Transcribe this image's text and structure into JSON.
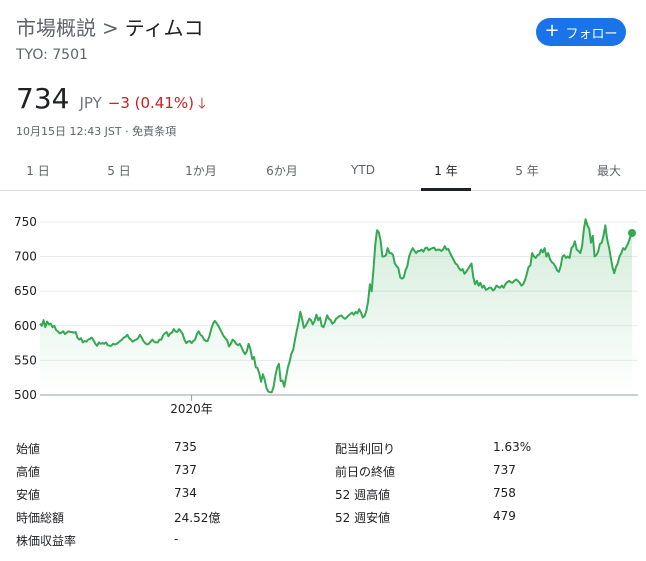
{
  "breadcrumb": {
    "overview": "市場概説",
    "separator": ">",
    "name": "ティムコ"
  },
  "ticker": "TYO: 7501",
  "follow_button": {
    "label": "フォロー",
    "icon": "plus-icon"
  },
  "quote": {
    "price": "734",
    "currency": "JPY",
    "change": "−3 (0.41%)",
    "direction_icon": "arrow-down-icon"
  },
  "timestamp": "10月15日 12:43 JST · 免責条項",
  "tabs": [
    {
      "label": "1 日",
      "active": false
    },
    {
      "label": "5 日",
      "active": false
    },
    {
      "label": "1か月",
      "active": false
    },
    {
      "label": "6か月",
      "active": false
    },
    {
      "label": "YTD",
      "active": false
    },
    {
      "label": "1 年",
      "active": true
    },
    {
      "label": "5 年",
      "active": false
    },
    {
      "label": "最大",
      "active": false
    }
  ],
  "colors": {
    "line": "#34a853",
    "down": "#c5221f",
    "accent": "#1a73e8"
  },
  "chart_data": {
    "type": "line",
    "ylim": [
      500,
      760
    ],
    "y_ticks": [
      500,
      550,
      600,
      650,
      700,
      750
    ],
    "x_tick_labels": [
      {
        "label": "2020年",
        "position": 0.256
      }
    ],
    "grid": true,
    "series": [
      {
        "values": [
          603,
          600,
          608,
          598,
          606,
          602,
          603,
          598,
          600,
          594,
          592,
          589,
          590,
          592,
          588,
          590,
          592,
          591,
          591,
          590,
          591,
          583,
          580,
          582,
          576,
          578,
          577,
          580,
          581,
          583,
          579,
          574,
          571,
          576,
          574,
          575,
          574,
          576,
          572,
          571,
          571,
          574,
          573,
          574,
          576,
          578,
          580,
          583,
          584,
          587,
          582,
          580,
          577,
          579,
          580,
          582,
          587,
          583,
          578,
          575,
          573,
          574,
          577,
          580,
          577,
          576,
          576,
          580,
          580,
          586,
          589,
          591,
          585,
          589,
          590,
          595,
          592,
          591,
          595,
          592,
          588,
          580,
          575,
          577,
          578,
          575,
          578,
          580,
          588,
          592,
          587,
          585,
          580,
          578,
          578,
          585,
          595,
          603,
          607,
          604,
          600,
          595,
          590,
          585,
          582,
          579,
          570,
          574,
          580,
          578,
          574,
          572,
          574,
          569,
          563,
          559,
          563,
          574,
          566,
          552,
          555,
          540,
          539,
          531,
          519,
          530,
          522,
          510,
          505,
          504,
          504,
          512,
          528,
          540,
          545,
          520,
          521,
          512,
          526,
          540,
          548,
          560,
          565,
          580,
          593,
          605,
          620,
          610,
          597,
          600,
          605,
          610,
          608,
          602,
          607,
          616,
          608,
          612,
          600,
          598,
          605,
          615,
          610,
          608,
          603,
          605,
          610,
          612,
          614,
          615,
          612,
          610,
          612,
          615,
          617,
          619,
          616,
          620,
          618,
          624,
          619,
          612,
          614,
          621,
          635,
          660,
          650,
          680,
          716,
          738,
          735,
          723,
          700,
          700,
          702,
          712,
          705,
          705,
          702,
          690,
          686,
          683,
          670,
          668,
          670,
          680,
          686,
          700,
          707,
          712,
          708,
          705,
          708,
          708,
          710,
          707,
          712,
          713,
          709,
          711,
          712,
          713,
          709,
          710,
          710,
          708,
          710,
          715,
          710,
          711,
          705,
          700,
          695,
          690,
          688,
          683,
          680,
          682,
          675,
          678,
          682,
          686,
          690,
          670,
          660,
          665,
          658,
          662,
          655,
          658,
          652,
          653,
          655,
          655,
          651,
          653,
          658,
          656,
          655,
          658,
          655,
          660,
          663,
          665,
          663,
          662,
          665,
          667,
          665,
          662,
          658,
          660,
          666,
          675,
          685,
          687,
          705,
          700,
          698,
          702,
          703,
          710,
          706,
          712,
          700,
          705,
          696,
          692,
          690,
          686,
          680,
          678,
          686,
          700,
          702,
          698,
          700,
          698,
          712,
          715,
          722,
          710,
          708,
          705,
          715,
          740,
          754,
          745,
          740,
          720,
          730,
          700,
          702,
          707,
          718,
          720,
          730,
          745,
          726,
          715,
          700,
          685,
          676,
          685,
          690,
          700,
          705,
          712,
          710,
          715,
          720,
          728,
          734
        ]
      }
    ]
  },
  "stats": {
    "left": [
      {
        "label": "始値",
        "value": "735"
      },
      {
        "label": "高値",
        "value": "737"
      },
      {
        "label": "安値",
        "value": "734"
      },
      {
        "label": "時価総額",
        "value": "24.52億"
      },
      {
        "label": "株価収益率",
        "value": "-"
      }
    ],
    "right": [
      {
        "label": "配当利回り",
        "value": "1.63%"
      },
      {
        "label": "前日の終値",
        "value": "737"
      },
      {
        "label": "52 週高値",
        "value": "758"
      },
      {
        "label": "52 週安値",
        "value": "479"
      }
    ]
  }
}
